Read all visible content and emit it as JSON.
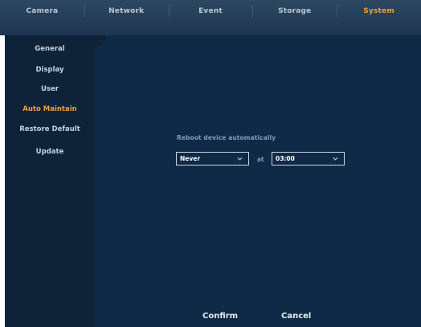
{
  "nav": {
    "tabs": [
      {
        "label": "Camera"
      },
      {
        "label": "Network"
      },
      {
        "label": "Event"
      },
      {
        "label": "Storage"
      },
      {
        "label": "System",
        "active": true
      }
    ]
  },
  "sidebar": {
    "items": [
      {
        "label": "General"
      },
      {
        "label": "Display"
      },
      {
        "label": "User"
      },
      {
        "label": "Auto Maintain",
        "active": true
      },
      {
        "label": "Restore Default"
      },
      {
        "label": "Update"
      }
    ]
  },
  "auto_maintain": {
    "reboot_label": "Reboot device automatically",
    "frequency_value": "Never",
    "at_label": "at",
    "time_value": "03:00"
  },
  "actions": {
    "confirm_label": "Confirm",
    "cancel_label": "Cancel"
  },
  "colors": {
    "accent": "#e8a43a",
    "panel": "#0f2a47",
    "sidebar": "#0e2238",
    "topbar": "#1e3550"
  }
}
